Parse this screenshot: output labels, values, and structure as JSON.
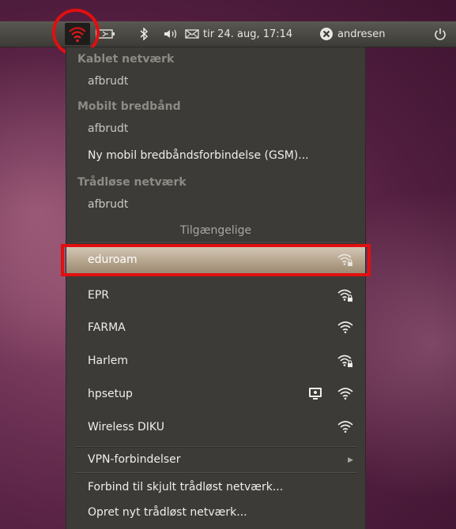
{
  "panel": {
    "date_time": "tir 24. aug, 17:14",
    "user": "andresen",
    "icons": [
      "network-icon",
      "battery-icon",
      "bluetooth-icon",
      "volume-icon",
      "mail-icon",
      "user-status-icon",
      "power-icon"
    ]
  },
  "menu": {
    "wired_header": "Kablet netværk",
    "wired_status": "afbrudt",
    "mobile_header": "Mobilt bredbånd",
    "mobile_status": "afbrudt",
    "mobile_new": "Ny mobil bredbåndsforbindelse (GSM)...",
    "wireless_header": "Trådløse netværk",
    "wireless_status": "afbrudt",
    "available_label": "Tilgængelige",
    "networks": [
      {
        "name": "eduroam",
        "secured": true,
        "selected": true
      },
      {
        "name": "EPR",
        "secured": true,
        "selected": false
      },
      {
        "name": "FARMA",
        "secured": false,
        "selected": false
      },
      {
        "name": "Harlem",
        "secured": true,
        "selected": false
      },
      {
        "name": "hpsetup",
        "secured": false,
        "selected": false,
        "adhoc": true
      },
      {
        "name": "Wireless DIKU",
        "secured": false,
        "selected": false
      }
    ],
    "vpn": "VPN-forbindelser",
    "hidden": "Forbind til skjult trådløst netværk...",
    "create": "Opret nyt trådløst netværk..."
  },
  "colors": {
    "annotation": "#e01010",
    "menu_bg": "#3c3b37",
    "selection": "#b6a58e"
  }
}
